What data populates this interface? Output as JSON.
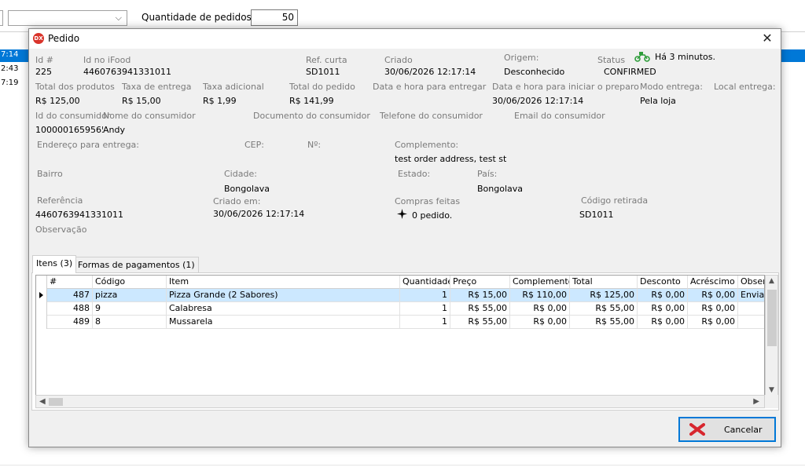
{
  "background": {
    "qty_label": "Quantidade de pedidos:",
    "qty_value": "50",
    "times": [
      "7:14",
      "2:43",
      "7:19"
    ]
  },
  "dialog": {
    "title": "Pedido",
    "close": "✕",
    "fields": {
      "id_label": "Id #",
      "id_value": "225",
      "idifood_label": "Id no iFood",
      "idifood_value": "4460763941331011",
      "refcurta_label": "Ref. curta",
      "refcurta_value": "SD1011",
      "criado_label": "Criado",
      "criado_value": "30/06/2026 12:17:14",
      "origem_label": "Origem:",
      "origem_value": "Desconhecido",
      "status_label": "Status",
      "status_value": "CONFIRMED",
      "status_time": "Há 3 minutos.",
      "totalprod_label": "Total dos produtos",
      "totalprod_value": "R$ 125,00",
      "taxaentrega_label": "Taxa de entrega",
      "taxaentrega_value": "R$ 15,00",
      "taxaadic_label": "Taxa adicional",
      "taxaadic_value": "R$ 1,99",
      "totalped_label": "Total do pedido",
      "totalped_value": "R$ 141,99",
      "datahoraentregar_label": "Data e hora para entregar",
      "datahorapreparo_label": "Data e hora para iniciar o preparo",
      "datahorapreparo_value": "30/06/2026 12:17:14",
      "modoentrega_label": "Modo entrega:",
      "modoentrega_value": "Pela loja",
      "localentrega_label": "Local entrega:",
      "idconsumidor_label": "Id do consumidor",
      "idconsumidor_value": "1000001659565",
      "nomeconsumidor_label": "Nome do consumidor",
      "nomeconsumidor_value": "Andy",
      "docconsumidor_label": "Documento do consumidor",
      "telconsumidor_label": "Telefone do consumidor",
      "emailconsumidor_label": "Email do consumidor",
      "endereco_label": "Endereço para entrega:",
      "cep_label": "CEP:",
      "numero_label": "Nº:",
      "complemento_label": "Complemento:",
      "complemento_value": "test order address, test st",
      "bairro_label": "Bairro",
      "cidade_label": "Cidade:",
      "cidade_value": "Bongolava",
      "estado_label": "Estado:",
      "pais_label": "País:",
      "pais_value": "Bongolava",
      "referencia_label": "Referência",
      "referencia_value": "4460763941331011",
      "criadoem_label": "Criado em:",
      "criadoem_value": "30/06/2026 12:17:14",
      "compras_label": "Compras feitas",
      "compras_value": "0 pedido.",
      "codretirada_label": "Código retirada",
      "codretirada_value": "SD1011",
      "observacao_label": "Observação"
    },
    "tabs": [
      {
        "label": "Itens (3)"
      },
      {
        "label": "Formas de pagamentos (1)"
      }
    ],
    "grid": {
      "columns": [
        "#",
        "Código",
        "Item",
        "Quantidade",
        "Preço",
        "Complementos",
        "Total",
        "Desconto",
        "Acréscimo",
        "Observ"
      ],
      "rows": [
        [
          "487",
          "pizza",
          "Pizza Grande (2 Sabores)",
          "1",
          "R$ 15,00",
          "R$ 110,00",
          "R$ 125,00",
          "R$ 0,00",
          "R$ 0,00",
          "Enviar"
        ],
        [
          "488",
          "9",
          "Calabresa",
          "1",
          "R$ 55,00",
          "R$ 0,00",
          "R$ 55,00",
          "R$ 0,00",
          "R$ 0,00",
          ""
        ],
        [
          "489",
          "8",
          "Mussarela",
          "1",
          "R$ 55,00",
          "R$ 0,00",
          "R$ 55,00",
          "R$ 0,00",
          "R$ 0,00",
          ""
        ]
      ]
    },
    "cancel_label": "Cancelar"
  }
}
